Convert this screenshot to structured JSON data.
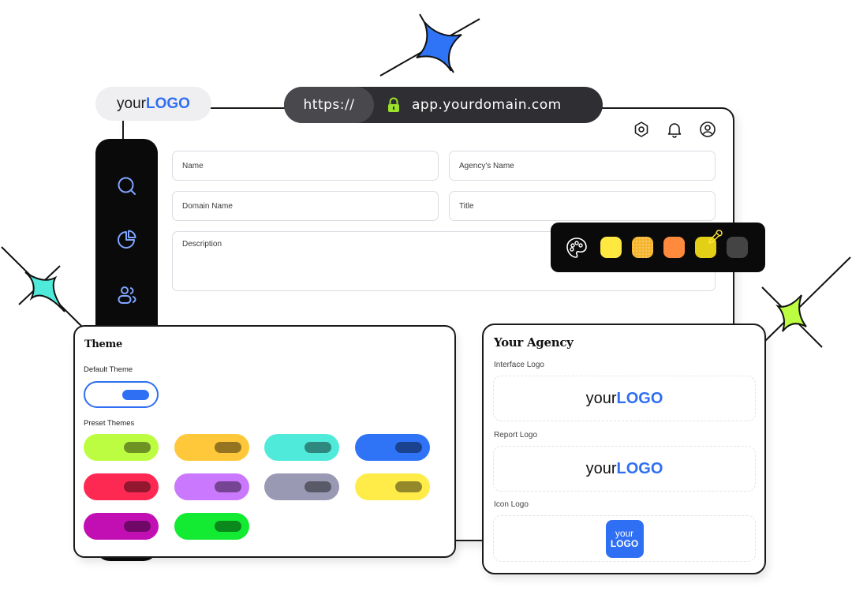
{
  "brand": {
    "your_text": "your",
    "logo_text": "LOGO",
    "accent_color": "#2e6ff3"
  },
  "url_bar": {
    "scheme": "https://",
    "host": "app.yourdomain.com",
    "lock_icon": "lock-icon",
    "lock_color": "#9be22a"
  },
  "header_icons": [
    "settings-hexagon-icon",
    "bell-icon",
    "user-circle-icon"
  ],
  "sidebar": {
    "items": [
      {
        "icon": "search-icon"
      },
      {
        "icon": "pie-chart-icon"
      },
      {
        "icon": "users-icon"
      }
    ],
    "icon_color": "#7ea4ff"
  },
  "form": {
    "name_placeholder": "Name",
    "agency_name_placeholder": "Agency's Name",
    "domain_name_placeholder": "Domain Name",
    "title_placeholder": "Title",
    "description_placeholder": "Description"
  },
  "palette": {
    "icon": "palette-icon",
    "swatches": [
      {
        "color": "#ffe940",
        "pattern": "solid"
      },
      {
        "color": "#f6b52c",
        "pattern": "dotted"
      },
      {
        "color": "#ff8a3d",
        "pattern": "solid"
      },
      {
        "color": "#e3cf16",
        "pattern": "solid",
        "picker": "eyedropper-icon"
      },
      {
        "color": "#444444",
        "pattern": "solid"
      }
    ]
  },
  "theme_card": {
    "title": "Theme",
    "default_label": "Default Theme",
    "default_toggle_color": "#2e6ff3",
    "preset_label": "Preset Themes",
    "presets": [
      {
        "color": "#bdfd41"
      },
      {
        "color": "#ffc83a"
      },
      {
        "color": "#50eadb"
      },
      {
        "color": "#2f73f6"
      },
      {
        "color": "#fe2952"
      },
      {
        "color": "#ca78fd"
      },
      {
        "color": "#9999b4"
      },
      {
        "color": "#ffec49"
      },
      {
        "color": "#c20fb4"
      },
      {
        "color": "#12eb31"
      }
    ]
  },
  "agency_card": {
    "title": "Your Agency",
    "interface_logo_label": "Interface Logo",
    "report_logo_label": "Report Logo",
    "icon_logo_label": "Icon Logo"
  },
  "decorations": {
    "sparkle_colors": [
      "#2f73f6",
      "#50eadb",
      "#bdfd41"
    ]
  }
}
